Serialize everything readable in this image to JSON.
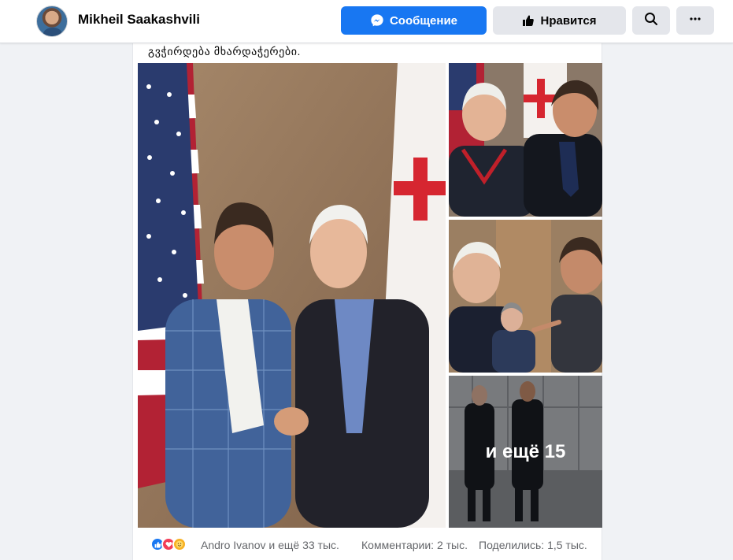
{
  "header": {
    "page_name": "Mikheil Saakashvili",
    "message_button": "Сообщение",
    "like_button": "Нравится",
    "search_icon": "search-icon",
    "more_icon": "more-icon"
  },
  "post": {
    "text": "გვჭირდება მხარდაჭერები.",
    "photos": [
      {
        "name": "photo-main"
      },
      {
        "name": "photo-1"
      },
      {
        "name": "photo-2"
      },
      {
        "name": "photo-3"
      }
    ],
    "more_photos_label": "и ещё 15"
  },
  "footer": {
    "reactions": [
      "like",
      "love",
      "care"
    ],
    "reaction_names": "Andro Ivanov и ещё 33 тыс.",
    "comments": "Комментарии: 2 тыс.",
    "shares": "Поделились: 1,5 тыс."
  },
  "colors": {
    "brand_blue": "#1877f2",
    "button_gray": "#e4e6eb",
    "secondary_text": "#65676b"
  }
}
